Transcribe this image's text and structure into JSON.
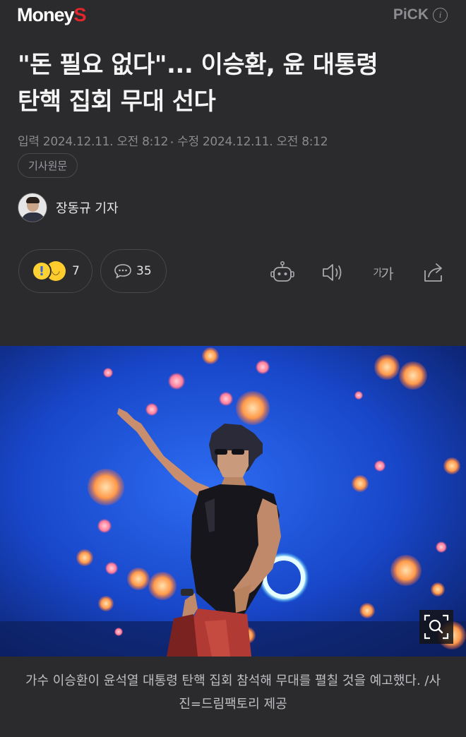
{
  "header": {
    "logo_main": "Money",
    "logo_accent": "S",
    "pick_label": "PiCK",
    "info_label": "i"
  },
  "article": {
    "headline_line1": "\"돈 필요 없다\"... 이승환, 윤 대통령",
    "headline_line2": "탄핵 집회 무대 선다",
    "published_label": "입력",
    "published": "2024.12.11. 오전 8:12",
    "modified_label": "수정",
    "modified": "2024.12.11. 오전 8:12",
    "origin_button": "기사원문",
    "author": "장동규 기자"
  },
  "actions": {
    "reaction_count": "7",
    "comment_count": "35",
    "font_size_label_small": "가",
    "font_size_label_large": "가"
  },
  "photo": {
    "caption": "가수 이승환이 윤석열 대통령 탄핵 집회 참석해 무대를 펼칠 것을 예고했다. /사진=드림팩토리 제공"
  },
  "colors": {
    "background": "#2b2b2d",
    "logo_accent": "#e3262c",
    "muted_text": "#8a8a8e",
    "stage_blue": "#1a4fd6",
    "stage_orange": "#ff9a4a"
  },
  "icons": [
    "info-icon",
    "surprise-emoji-icon",
    "happy-emoji-icon",
    "comment-icon",
    "robot-icon",
    "speaker-icon",
    "font-size-icon",
    "share-icon",
    "zoom-icon"
  ]
}
